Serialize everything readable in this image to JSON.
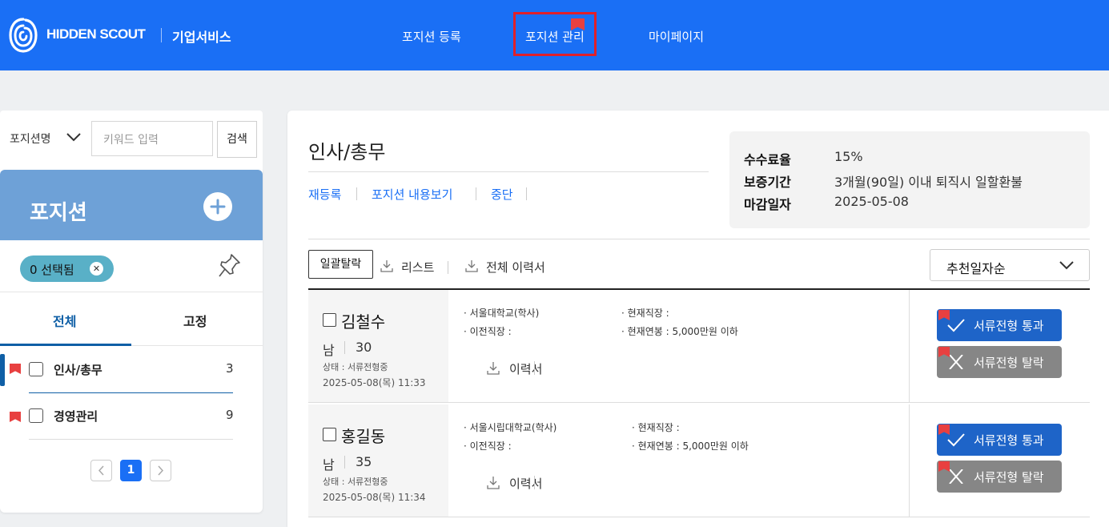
{
  "header": {
    "brand": "HIDDEN SCOUT",
    "sub": "기업서비스",
    "nav": [
      "포지션 등록",
      "포지션 관리",
      "마이페이지"
    ]
  },
  "sidebar": {
    "search": {
      "select_label": "포지션명",
      "placeholder": "키워드 입력",
      "button": "검색"
    },
    "title": "포지션",
    "selected_chip": "0 선택됨",
    "tabs": [
      "전체",
      "고정"
    ],
    "positions": [
      {
        "name": "인사/총무",
        "count": "3"
      },
      {
        "name": "경영관리",
        "count": "9"
      }
    ],
    "pagination": {
      "current": "1"
    }
  },
  "main": {
    "title": "인사/총무",
    "actions": [
      "재등록",
      "포지션 내용보기",
      "중단"
    ],
    "info": [
      {
        "label": "수수료율",
        "value": "15%"
      },
      {
        "label": "보증기간",
        "value": "3개월(90일) 이내 퇴직시 일할환불"
      },
      {
        "label": "마감일자",
        "value": "2025-05-08"
      }
    ],
    "toolbar": {
      "bulk": "일괄탈락",
      "list": "리스트",
      "all_resume": "전체 이력서",
      "sort": "추천일자순"
    },
    "candidates": [
      {
        "name": "김철수",
        "sex": "남",
        "age": "30",
        "status": "상태 : 서류전형중",
        "date": "2025-05-08(목) 11:33",
        "school": "· 서울대학교(학사)",
        "prev_job": "· 이전직장 :",
        "cur_job": "· 현재직장 :",
        "salary": "· 현재연봉 : 5,000만원 이하",
        "resume": "이력서",
        "pass": "서류전형 통과",
        "drop": "서류전형 탈락"
      },
      {
        "name": "홍길동",
        "sex": "남",
        "age": "35",
        "status": "상태 : 서류전형중",
        "date": "2025-05-08(목) 11:34",
        "school": "· 서울시립대학교(학사)",
        "prev_job": "· 이전직장 :",
        "cur_job": "· 현재직장 :",
        "salary": "· 현재연봉 : 5,000만원 이하",
        "resume": "이력서",
        "pass": "서류전형 통과",
        "drop": "서류전형 탈락"
      }
    ]
  },
  "colors": {
    "header_bg": "#1a6ff5",
    "position_header": "#6ea1d7",
    "chip": "#59b0c7",
    "pass": "#1e64c8",
    "drop": "#868686",
    "highlight": "#e0202a"
  }
}
